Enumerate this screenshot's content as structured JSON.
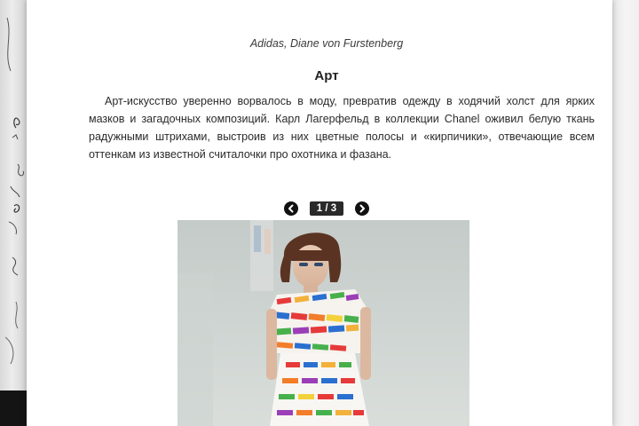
{
  "article": {
    "caption": "Adidas, Diane von Furstenberg",
    "section_title": "Арт",
    "paragraph": "Арт-искусство уверенно ворвалось в моду, превратив одежду в ходячий холст для ярких мазков и загадочных композиций. Карл Лагерфельд в коллекции Chanel оживил белую ткань радужными штрихами, выстроив из них цветные полосы и «кирпичики», отвечающие всем оттенкам из известной считалочки про охотника и фазана."
  },
  "gallery": {
    "counter": "1 / 3",
    "prev_icon": "chevron-left-icon",
    "next_icon": "chevron-right-icon"
  },
  "colors": {
    "card_background": "#ffffff",
    "nav_button": "#111111",
    "counter_background": "#2a2a2a"
  }
}
